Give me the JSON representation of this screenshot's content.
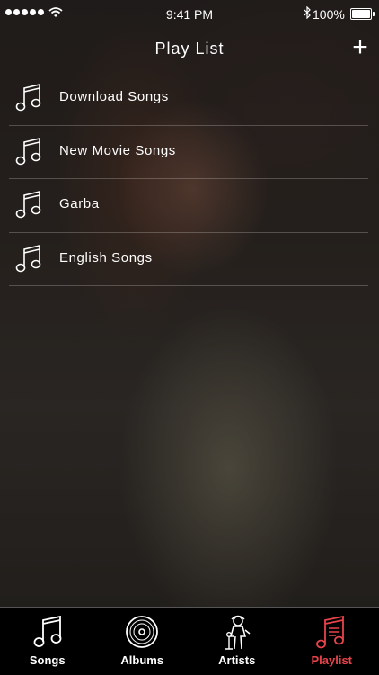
{
  "status_bar": {
    "time": "9:41 PM",
    "battery_percent": "100%",
    "icons": [
      "signal-dots-icon",
      "wifi-icon",
      "bluetooth-icon",
      "battery-icon"
    ]
  },
  "header": {
    "title": "Play List",
    "add_label": "+"
  },
  "playlists": [
    {
      "label": "Download Songs",
      "icon": "music-note-icon"
    },
    {
      "label": "New Movie Songs",
      "icon": "music-note-icon"
    },
    {
      "label": "Garba",
      "icon": "music-note-icon"
    },
    {
      "label": "English Songs",
      "icon": "music-note-icon"
    }
  ],
  "tabbar": {
    "active_color": "#e8434b",
    "tabs": [
      {
        "label": "Songs",
        "icon": "music-note-icon",
        "active": false
      },
      {
        "label": "Albums",
        "icon": "vinyl-disc-icon",
        "active": false
      },
      {
        "label": "Artists",
        "icon": "singer-icon",
        "active": false
      },
      {
        "label": "Playlist",
        "icon": "playlist-icon",
        "active": true
      }
    ]
  }
}
